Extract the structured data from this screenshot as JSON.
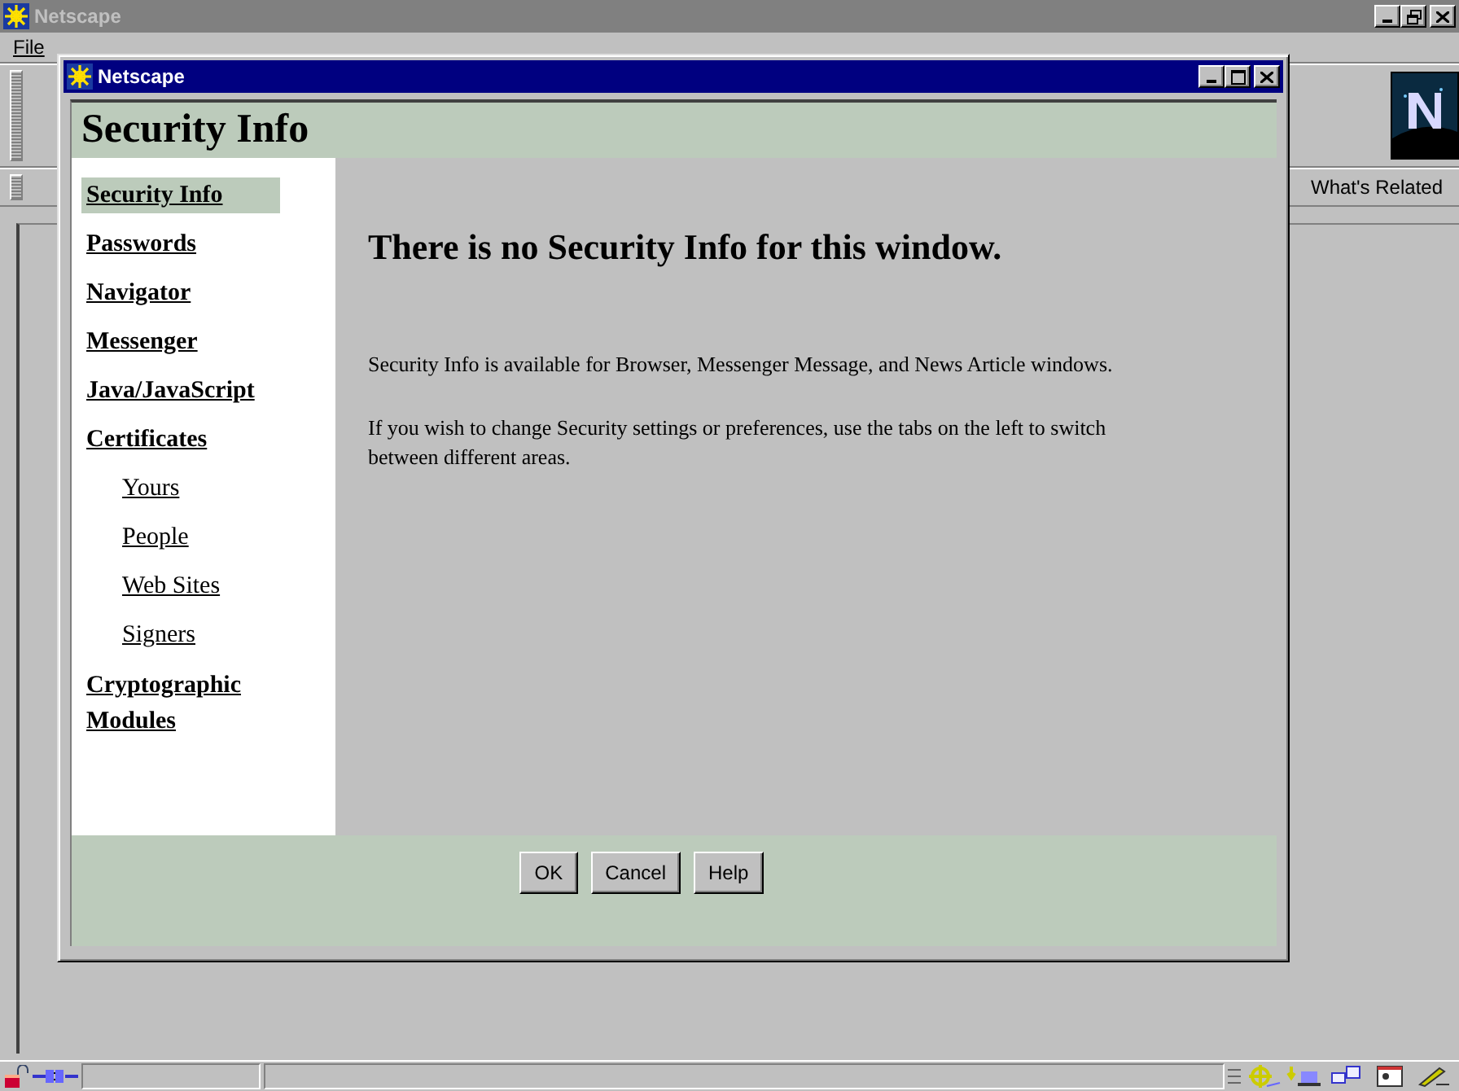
{
  "main_window": {
    "title": "Netscape",
    "menu": [
      "File"
    ],
    "toolbar_link": "What's Related"
  },
  "dialog": {
    "title": "Netscape",
    "heading": "Security Info",
    "nav": [
      {
        "label": "Security Info",
        "selected": true
      },
      {
        "label": "Passwords",
        "selected": false
      },
      {
        "label": "Navigator",
        "selected": false
      },
      {
        "label": "Messenger",
        "selected": false
      },
      {
        "label": "Java/JavaScript",
        "selected": false
      },
      {
        "label": "Certificates",
        "selected": false,
        "children": [
          {
            "label": "Yours",
            "selected": false
          },
          {
            "label": "People",
            "selected": false
          },
          {
            "label": "Web Sites",
            "selected": false
          },
          {
            "label": "Signers",
            "selected": false
          }
        ]
      },
      {
        "label": "Cryptographic Modules",
        "selected": false
      }
    ],
    "message": "There is no Security Info for this window.",
    "paragraphs": [
      "Security Info is available for Browser, Messenger Message, and News Article windows.",
      "If you wish to change Security settings or preferences, use the tabs on the left to switch between different areas."
    ],
    "buttons": [
      "OK",
      "Cancel",
      "Help"
    ]
  }
}
